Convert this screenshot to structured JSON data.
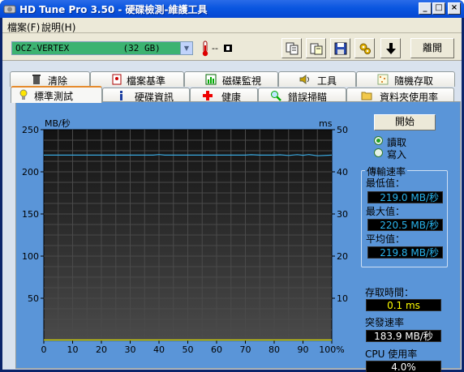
{
  "window": {
    "title": "HD Tune Pro 3.50 - 硬碟檢測-維護工具"
  },
  "menu": {
    "file": "檔案(F)",
    "help": "說明(H)"
  },
  "toolbar": {
    "drive": "OCZ-VERTEX          (32 GB)",
    "temperature": "--",
    "exit": "離開"
  },
  "tabs_top": [
    {
      "label": "清除"
    },
    {
      "label": "檔案基準"
    },
    {
      "label": "磁碟監視"
    },
    {
      "label": "工具"
    },
    {
      "label": "隨機存取"
    }
  ],
  "tabs_bottom": [
    {
      "label": "標準測試"
    },
    {
      "label": "硬碟資訊"
    },
    {
      "label": "健康"
    },
    {
      "label": "錯誤掃瞄"
    },
    {
      "label": "資料夾使用率"
    }
  ],
  "controls": {
    "start": "開始",
    "read": "讀取",
    "write": "寫入",
    "read_selected": true
  },
  "transfer": {
    "legend": "傳輸速率",
    "min_label": "最低值：",
    "min_value": "219.0 MB/秒",
    "max_label": "最大值：",
    "max_value": "220.5 MB/秒",
    "avg_label": "平均值：",
    "avg_value": "219.8 MB/秒"
  },
  "access": {
    "label": "存取時間：",
    "value": "0.1 ms"
  },
  "burst": {
    "label": "突發速率",
    "value": "183.9 MB/秒"
  },
  "cpu": {
    "label": "CPU 使用率",
    "value": "4.0%"
  },
  "chart_data": {
    "type": "line",
    "ylabel_left": "MB/秒",
    "ylabel_right": "ms",
    "ylim_left": [
      0,
      250
    ],
    "ylim_right": [
      0,
      50
    ],
    "yticks_left": [
      "250",
      "200",
      "150",
      "100",
      "50"
    ],
    "yticks_right": [
      "50",
      "40",
      "30",
      "20",
      "10"
    ],
    "xticks": [
      "0",
      "10",
      "20",
      "30",
      "40",
      "50",
      "60",
      "70",
      "80",
      "90",
      "100%"
    ],
    "grid": true,
    "series": [
      {
        "color": "#3aa9e0",
        "x": [
          0,
          5,
          10,
          15,
          20,
          25,
          30,
          35,
          38,
          40,
          42,
          45,
          50,
          55,
          60,
          65,
          70,
          72,
          75,
          80,
          82,
          85,
          88,
          90,
          92,
          95,
          100
        ],
        "y": [
          219.8,
          219.8,
          219.8,
          219.8,
          219.8,
          219.8,
          219.8,
          219.8,
          219.8,
          220.5,
          219.8,
          219.8,
          219.8,
          219.8,
          219.8,
          219.8,
          219.8,
          220.3,
          219.8,
          219.8,
          220.2,
          219.4,
          220.4,
          219.6,
          220.5,
          219.0,
          219.8
        ]
      },
      {
        "color": "#e8e800",
        "axis": "right",
        "x": [
          0,
          100
        ],
        "y": [
          0.1,
          0.1
        ]
      }
    ]
  }
}
